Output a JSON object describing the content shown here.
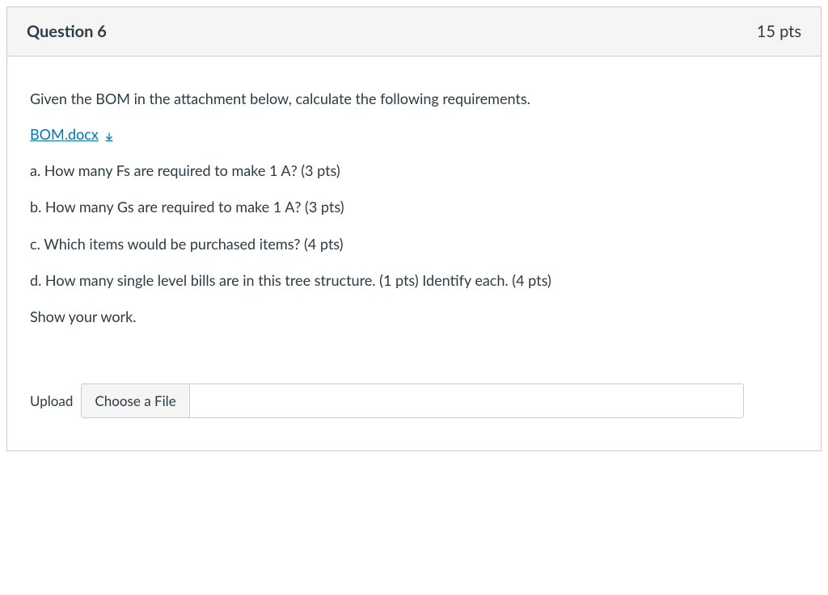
{
  "header": {
    "title": "Question 6",
    "points": "15 pts"
  },
  "body": {
    "intro": "Given the BOM in the attachment below, calculate the following requirements.",
    "attachment": {
      "label": "BOM.docx"
    },
    "parts": {
      "a": "a. How many Fs are required to make 1 A? (3 pts)",
      "b": "b. How many Gs are required to make 1 A? (3 pts)",
      "c": "c. Which items would be purchased items? (4 pts)",
      "d": "d. How many single level bills are in this tree structure. (1 pts) Identify each. (4 pts)"
    },
    "closing": "Show your work."
  },
  "upload": {
    "label": "Upload",
    "button": "Choose a File",
    "filename": ""
  }
}
